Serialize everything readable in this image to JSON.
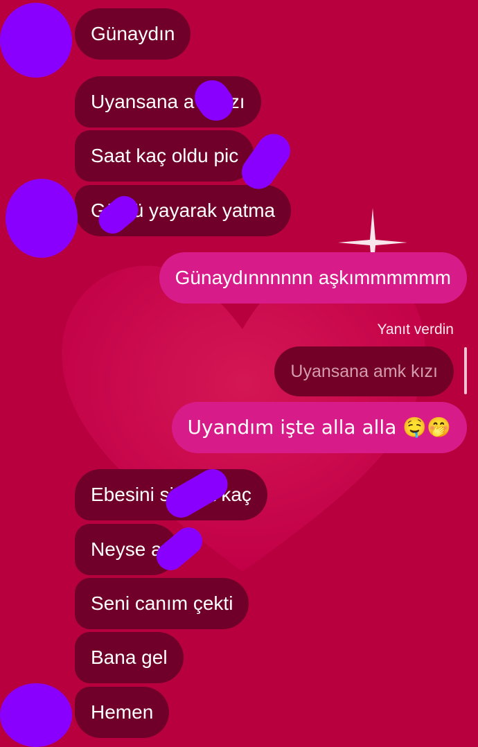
{
  "colors": {
    "background": "#b8003e",
    "incoming_bubble": "#700029",
    "outgoing_bubble": "#d71c8a",
    "redaction": "#8a00ff"
  },
  "messages": [
    {
      "side": "incoming",
      "text": "Günaydın"
    },
    {
      "side": "incoming",
      "text": "Uyansana a k kızı"
    },
    {
      "side": "incoming",
      "text": "Saat kaç oldu pic"
    },
    {
      "side": "incoming",
      "text": "Gö nü yayarak yatma"
    },
    {
      "side": "outgoing",
      "text": "Günaydınnnnnn aşkımmmmmm"
    },
    {
      "side": "outgoing",
      "text": "Uyandım işte alla alla 🤤🤭"
    },
    {
      "side": "incoming",
      "text": "Ebesini si saat kaç"
    },
    {
      "side": "incoming",
      "text": "Neyse a"
    },
    {
      "side": "incoming",
      "text": "Seni canım çekti"
    },
    {
      "side": "incoming",
      "text": "Bana gel"
    },
    {
      "side": "incoming",
      "text": "Hemen"
    }
  ],
  "reply": {
    "caption": "Yanıt verdin",
    "quoted_text": "Uyansana amk kızı"
  }
}
